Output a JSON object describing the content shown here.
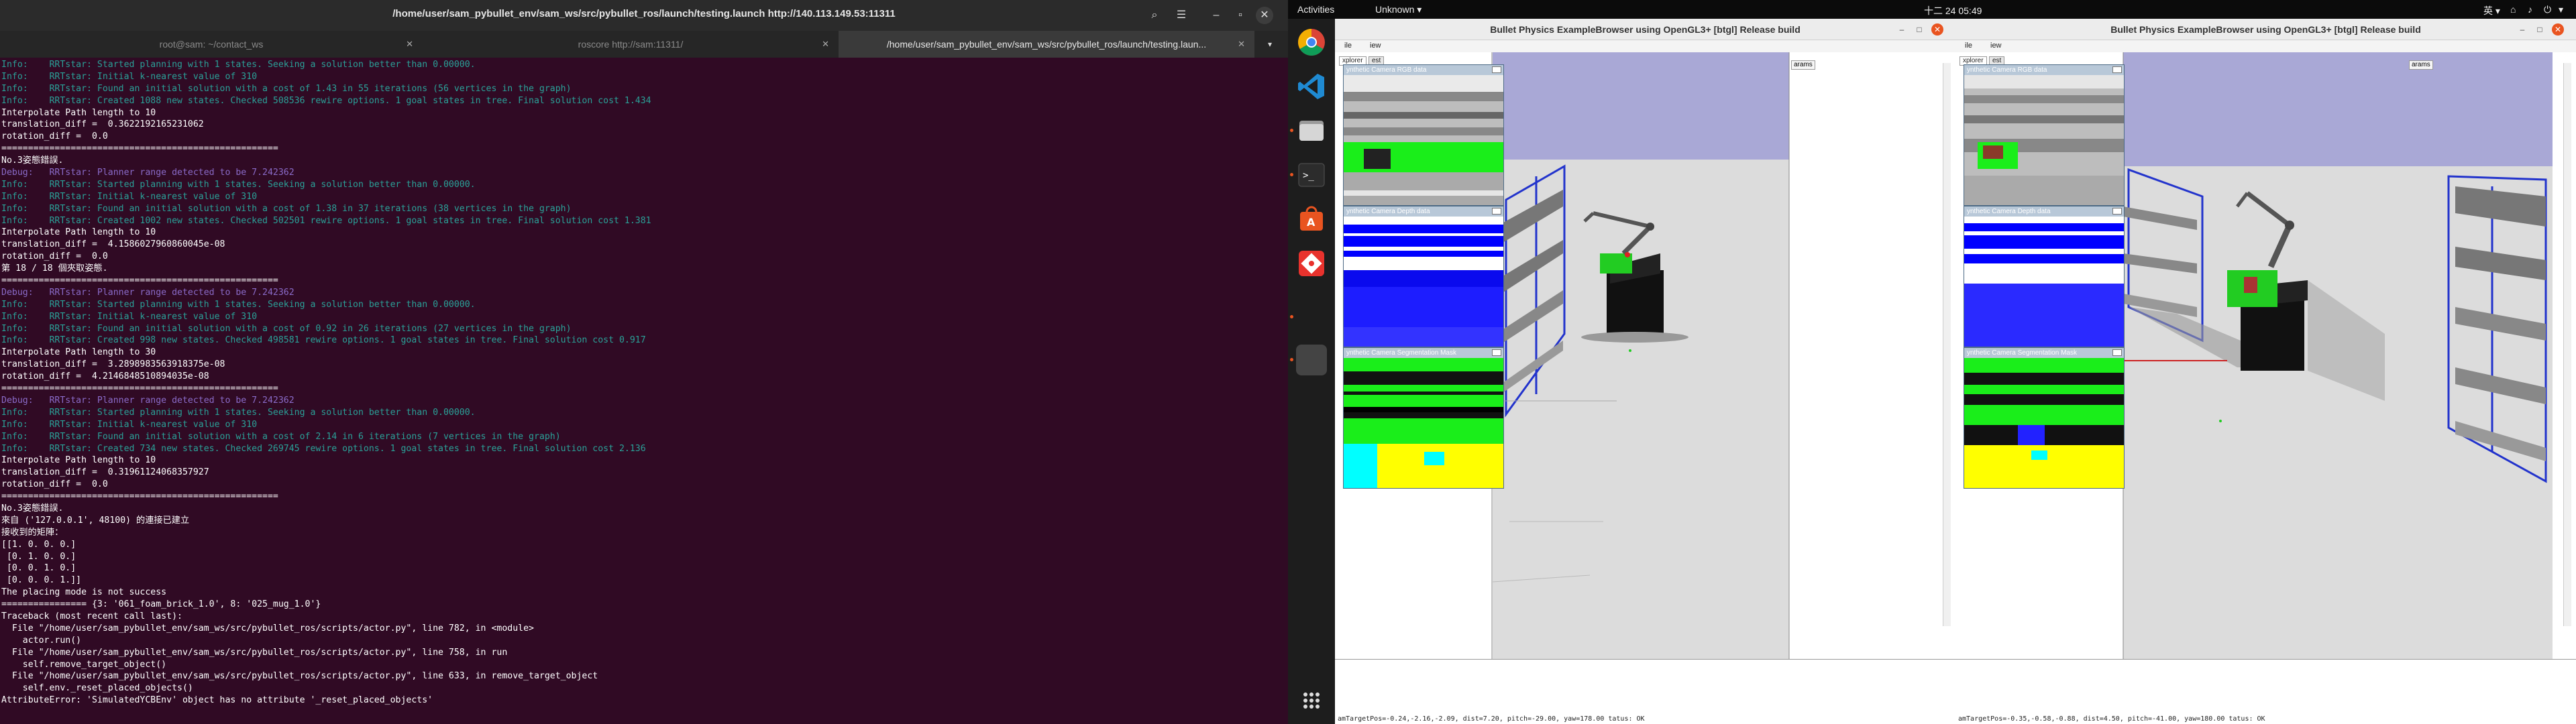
{
  "terminal": {
    "title": "/home/user/sam_pybullet_env/sam_ws/src/pybullet_ros/launch/testing.launch http://140.113.149.53:11311",
    "tabs": [
      {
        "label": "root@sam: ~/contact_ws"
      },
      {
        "label": "roscore http://sam:11311/"
      },
      {
        "label": "/home/user/sam_pybullet_env/sam_ws/src/pybullet_ros/launch/testing.laun..."
      }
    ],
    "lines": [
      {
        "t": "Info:    RRTstar: Started planning with 1 states. Seeking a solution better than 0.00000.",
        "c": "info"
      },
      {
        "t": "Info:    RRTstar: Initial k-nearest value of 310",
        "c": "info"
      },
      {
        "t": "Info:    RRTstar: Found an initial solution with a cost of 1.43 in 55 iterations (56 vertices in the graph)",
        "c": "info"
      },
      {
        "t": "Info:    RRTstar: Created 1088 new states. Checked 508536 rewire options. 1 goal states in tree. Final solution cost 1.434",
        "c": "info"
      },
      {
        "t": "Interpolate Path length to 10",
        "c": "text"
      },
      {
        "t": "translation_diff =  0.3622192165231062",
        "c": "text"
      },
      {
        "t": "rotation_diff =  0.0",
        "c": "text"
      },
      {
        "t": "====================================================",
        "c": "text"
      },
      {
        "t": "No.3姿態錯誤.",
        "c": "text"
      },
      {
        "t": "Debug:   RRTstar: Planner range detected to be 7.242362",
        "c": "debug"
      },
      {
        "t": "Info:    RRTstar: Started planning with 1 states. Seeking a solution better than 0.00000.",
        "c": "info"
      },
      {
        "t": "Info:    RRTstar: Initial k-nearest value of 310",
        "c": "info"
      },
      {
        "t": "Info:    RRTstar: Found an initial solution with a cost of 1.38 in 37 iterations (38 vertices in the graph)",
        "c": "info"
      },
      {
        "t": "Info:    RRTstar: Created 1002 new states. Checked 502501 rewire options. 1 goal states in tree. Final solution cost 1.381",
        "c": "info"
      },
      {
        "t": "Interpolate Path length to 10",
        "c": "text"
      },
      {
        "t": "translation_diff =  4.1586027960860045e-08",
        "c": "text"
      },
      {
        "t": "rotation_diff =  0.0",
        "c": "text"
      },
      {
        "t": "第 18 / 18 個夾取姿態.",
        "c": "text"
      },
      {
        "t": "====================================================",
        "c": "text"
      },
      {
        "t": "Debug:   RRTstar: Planner range detected to be 7.242362",
        "c": "debug"
      },
      {
        "t": "Info:    RRTstar: Started planning with 1 states. Seeking a solution better than 0.00000.",
        "c": "info"
      },
      {
        "t": "Info:    RRTstar: Initial k-nearest value of 310",
        "c": "info"
      },
      {
        "t": "Info:    RRTstar: Found an initial solution with a cost of 0.92 in 26 iterations (27 vertices in the graph)",
        "c": "info"
      },
      {
        "t": "Info:    RRTstar: Created 998 new states. Checked 498581 rewire options. 1 goal states in tree. Final solution cost 0.917",
        "c": "info"
      },
      {
        "t": "Interpolate Path length to 30",
        "c": "text"
      },
      {
        "t": "translation_diff =  3.2898983563918375e-08",
        "c": "text"
      },
      {
        "t": "rotation_diff =  4.2146848510894035e-08",
        "c": "text"
      },
      {
        "t": "====================================================",
        "c": "text"
      },
      {
        "t": "Debug:   RRTstar: Planner range detected to be 7.242362",
        "c": "debug"
      },
      {
        "t": "Info:    RRTstar: Started planning with 1 states. Seeking a solution better than 0.00000.",
        "c": "info"
      },
      {
        "t": "Info:    RRTstar: Initial k-nearest value of 310",
        "c": "info"
      },
      {
        "t": "Info:    RRTstar: Found an initial solution with a cost of 2.14 in 6 iterations (7 vertices in the graph)",
        "c": "info"
      },
      {
        "t": "Info:    RRTstar: Created 734 new states. Checked 269745 rewire options. 1 goal states in tree. Final solution cost 2.136",
        "c": "info"
      },
      {
        "t": "Interpolate Path length to 10",
        "c": "text"
      },
      {
        "t": "translation_diff =  0.31961124068357927",
        "c": "text"
      },
      {
        "t": "rotation_diff =  0.0",
        "c": "text"
      },
      {
        "t": "====================================================",
        "c": "text"
      },
      {
        "t": "No.3姿態錯誤.",
        "c": "text"
      },
      {
        "t": "來自 ('127.0.0.1', 48100) 的連接已建立",
        "c": "text"
      },
      {
        "t": "接收到的矩陣：",
        "c": "text"
      },
      {
        "t": "[[1. 0. 0. 0.]",
        "c": "text"
      },
      {
        "t": " [0. 1. 0. 0.]",
        "c": "text"
      },
      {
        "t": " [0. 0. 1. 0.]",
        "c": "text"
      },
      {
        "t": " [0. 0. 0. 1.]]",
        "c": "text"
      },
      {
        "t": "The placing mode is not success",
        "c": "text"
      },
      {
        "t": "================ {3: '061_foam_brick_1.0', 8: '025_mug_1.0'}",
        "c": "text"
      },
      {
        "t": "Traceback (most recent call last):",
        "c": "text"
      },
      {
        "t": "  File \"/home/user/sam_pybullet_env/sam_ws/src/pybullet_ros/scripts/actor.py\", line 782, in <module>",
        "c": "text"
      },
      {
        "t": "    actor.run()",
        "c": "text"
      },
      {
        "t": "  File \"/home/user/sam_pybullet_env/sam_ws/src/pybullet_ros/scripts/actor.py\", line 758, in run",
        "c": "text"
      },
      {
        "t": "    self.remove_target_object()",
        "c": "text"
      },
      {
        "t": "  File \"/home/user/sam_pybullet_env/sam_ws/src/pybullet_ros/scripts/actor.py\", line 633, in remove_target_object",
        "c": "text"
      },
      {
        "t": "    self.env._reset_placed_objects()",
        "c": "text"
      },
      {
        "t": "AttributeError: 'SimulatedYCBEnv' object has no attribute '_reset_placed_objects'",
        "c": "text"
      }
    ],
    "colors": {
      "background": "#300a24",
      "text": "#ffffff",
      "info": "#2aa198",
      "debug": "#8a6bc9"
    }
  },
  "panel": {
    "activities": "Activities",
    "app_menu": "Unknown ▾",
    "clock": "十二 24 05:49",
    "input_method": "英 ▾"
  },
  "dock": {
    "apps": [
      "chrome-icon",
      "vscode-icon",
      "files-icon",
      "terminal-icon",
      "software-center-icon",
      "git-icon"
    ],
    "show_apps": "show-apps-icon"
  },
  "bullet_left": {
    "title": "Bullet Physics ExampleBrowser using OpenGL3+ [btgl] Release build",
    "menu": [
      "ile",
      "iew"
    ],
    "tabs": [
      "xplorer",
      "est"
    ],
    "params_label": "arams",
    "cameras": [
      "ynthetic Camera RGB data",
      "ynthetic Camera Depth data",
      "ynthetic Camera Segmentation Mask"
    ],
    "status": "amTargetPos=-0.24,-2.16,-2.09, dist=7.20, pitch=-29.00, yaw=178.00  tatus: OK"
  },
  "bullet_right": {
    "title": "Bullet Physics ExampleBrowser using OpenGL3+ [btgl] Release build",
    "menu": [
      "ile",
      "iew"
    ],
    "tabs": [
      "xplorer",
      "est"
    ],
    "params_label": "arams",
    "cameras": [
      "ynthetic Camera RGB data",
      "ynthetic Camera Depth data",
      "ynthetic Camera Segmentation Mask"
    ],
    "status": "amTargetPos=-0.35,-0.58,-0.88, dist=4.50, pitch=-41.00, yaw=180.00  tatus: OK"
  }
}
